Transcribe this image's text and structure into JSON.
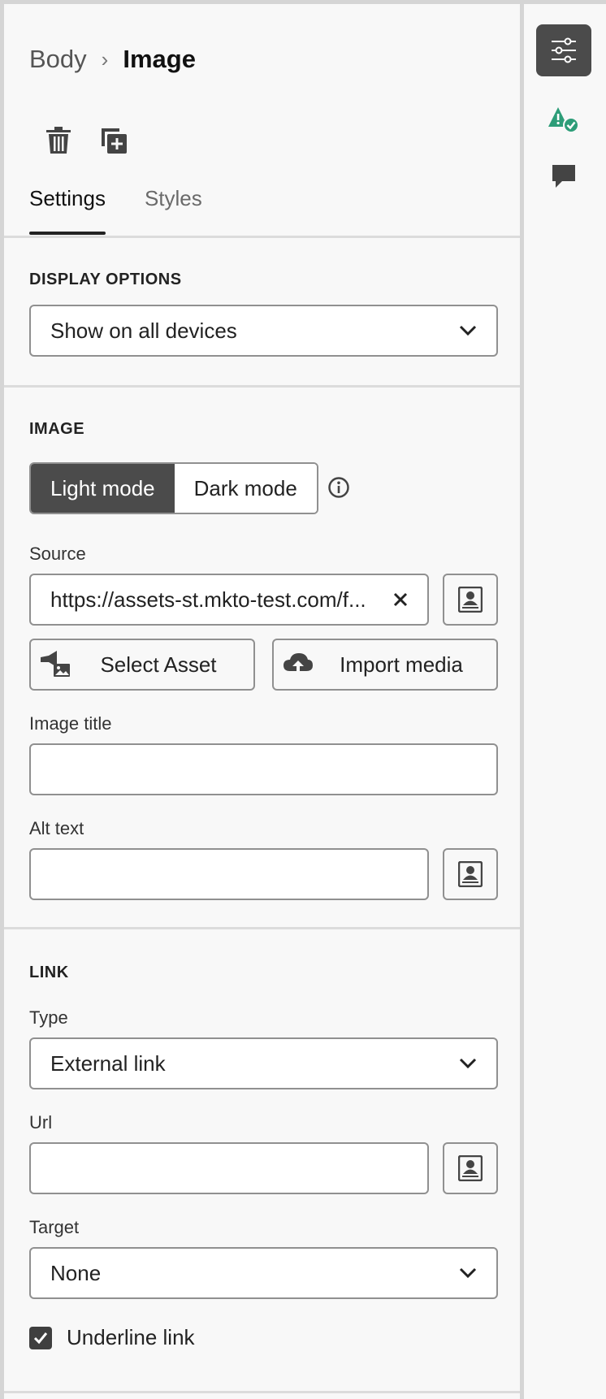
{
  "breadcrumb": {
    "parent": "Body",
    "separator": "›",
    "current": "Image"
  },
  "tabs": [
    {
      "label": "Settings"
    },
    {
      "label": "Styles"
    }
  ],
  "display_options": {
    "title": "DISPLAY OPTIONS",
    "value": "Show on all devices"
  },
  "image": {
    "title": "IMAGE",
    "modes": {
      "light": "Light mode",
      "dark": "Dark mode"
    },
    "source_label": "Source",
    "source_value": "https://assets-st.mkto-test.com/f...",
    "select_asset": "Select Asset",
    "import_media": "Import media",
    "image_title_label": "Image title",
    "image_title_value": "",
    "alt_text_label": "Alt text",
    "alt_text_value": ""
  },
  "link": {
    "title": "LINK",
    "type_label": "Type",
    "type_value": "External link",
    "url_label": "Url",
    "url_value": "",
    "target_label": "Target",
    "target_value": "None",
    "underline_label": "Underline link",
    "underline_checked": true
  },
  "rail": {
    "icons": [
      "settings-sliders-icon",
      "validation-status-icon",
      "comment-icon"
    ]
  },
  "colors": {
    "accent": "#4b4b4b",
    "success": "#2d9d78",
    "field_border": "#909090"
  }
}
